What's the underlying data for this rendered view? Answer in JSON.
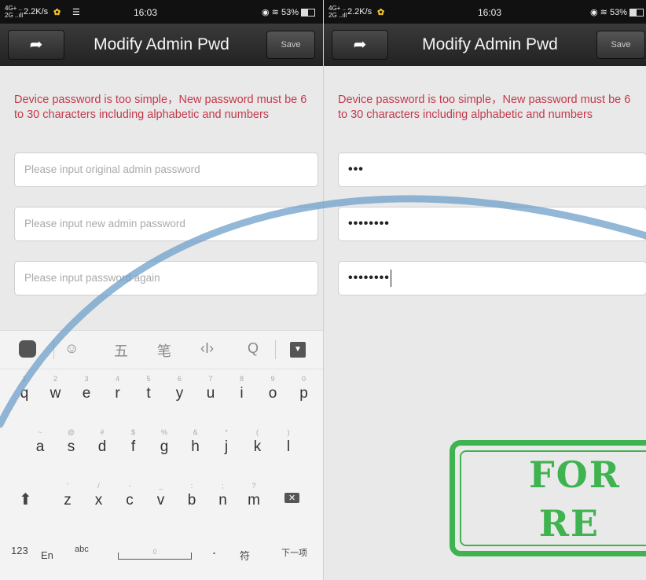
{
  "screens": [
    {
      "status": {
        "signal": "4G+ ..\n2G ..ıll",
        "speed": "2.2K/s",
        "time": "16:03",
        "battery": "53%"
      },
      "title": "Modify Admin Pwd",
      "save_label": "Save",
      "notice": "Device password is too simple，New password must be 6 to 30 characters including alphabetic and numbers",
      "fields": [
        {
          "placeholder": "Please input original admin password",
          "value": ""
        },
        {
          "placeholder": "Please input new admin password",
          "value": ""
        },
        {
          "placeholder": "Please input password again",
          "value": ""
        }
      ]
    },
    {
      "status": {
        "signal": "4G+ ..\n2G ..ıll",
        "speed": "2.2K/s",
        "time": "16:03",
        "battery": "53%"
      },
      "title": "Modify Admin Pwd",
      "save_label": "Save",
      "notice": "Device password is too simple，New password must be 6 to 30 characters including alphabetic and numbers",
      "fields": [
        {
          "placeholder": "",
          "value": "•••"
        },
        {
          "placeholder": "",
          "value": "••••••••"
        },
        {
          "placeholder": "",
          "value": "••••••••"
        }
      ]
    }
  ],
  "keyboard": {
    "toolbar": [
      "☺",
      "五",
      "笔",
      "‹I›",
      "Q"
    ],
    "row1": [
      {
        "k": "q",
        "h": "1"
      },
      {
        "k": "w",
        "h": "2"
      },
      {
        "k": "e",
        "h": "3"
      },
      {
        "k": "r",
        "h": "4"
      },
      {
        "k": "t",
        "h": "5"
      },
      {
        "k": "y",
        "h": "6"
      },
      {
        "k": "u",
        "h": "7"
      },
      {
        "k": "i",
        "h": "8"
      },
      {
        "k": "o",
        "h": "9"
      },
      {
        "k": "p",
        "h": "0"
      }
    ],
    "row2": [
      {
        "k": "a",
        "h": "~"
      },
      {
        "k": "s",
        "h": "@"
      },
      {
        "k": "d",
        "h": "#"
      },
      {
        "k": "f",
        "h": "$"
      },
      {
        "k": "g",
        "h": "%"
      },
      {
        "k": "h",
        "h": "&"
      },
      {
        "k": "j",
        "h": "*"
      },
      {
        "k": "k",
        "h": "("
      },
      {
        "k": "l",
        "h": ")"
      }
    ],
    "row3": [
      {
        "k": "z",
        "h": "'"
      },
      {
        "k": "x",
        "h": "/"
      },
      {
        "k": "c",
        "h": "-"
      },
      {
        "k": "v",
        "h": "_"
      },
      {
        "k": "b",
        "h": ":"
      },
      {
        "k": "n",
        "h": ";"
      },
      {
        "k": "m",
        "h": "?"
      }
    ],
    "bottom": {
      "num": "123",
      "en": "En",
      "abc": "abc",
      "space": "0",
      "dot": ".",
      "symbol": "符",
      "next": "下一项"
    }
  },
  "watermark": "FOR RE",
  "colors": {
    "notice": "#c4394a",
    "stamp": "#3fb34f",
    "arc": "#6f9fc8"
  }
}
